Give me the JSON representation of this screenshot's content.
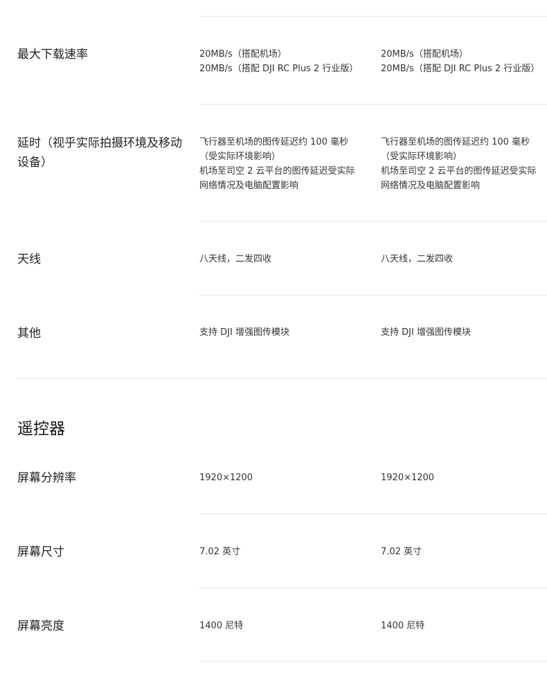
{
  "network_rows": {
    "download_rate": {
      "label": "最大下载速率",
      "col1": [
        "20MB/s（搭配机场）",
        "20MB/s（搭配 DJI RC Plus 2 行业版）"
      ],
      "col2": [
        "20MB/s（搭配机场）",
        "20MB/s（搭配 DJI RC Plus 2 行业版）"
      ]
    },
    "latency": {
      "label": "延时（视乎实际拍摄环境及移动设备）",
      "col1": [
        "飞行器至机场的图传延迟约 100 毫秒",
        "（受实际环境影响）",
        "机场至司空 2 云平台的图传延迟受实际",
        "网络情况及电脑配置影响"
      ],
      "col2": [
        "飞行器至机场的图传延迟约 100 毫秒",
        "（受实际环境影响）",
        "机场至司空 2 云平台的图传延迟受实际",
        "网络情况及电脑配置影响"
      ]
    },
    "antenna": {
      "label": "天线",
      "col1": "八天线，二发四收",
      "col2": "八天线，二发四收"
    },
    "other": {
      "label": "其他",
      "col1": "支持 DJI 增强图传模块",
      "col2": "支持 DJI 增强图传模块"
    }
  },
  "remote_controller": {
    "title": "遥控器",
    "rows": {
      "resolution": {
        "label": "屏幕分辨率",
        "col1": "1920×1200",
        "col2": "1920×1200"
      },
      "size": {
        "label": "屏幕尺寸",
        "col1": "7.02 英寸",
        "col2": "7.02 英寸"
      },
      "brightness": {
        "label": "屏幕亮度",
        "col1": "1400 尼特",
        "col2": "1400 尼特"
      }
    }
  }
}
